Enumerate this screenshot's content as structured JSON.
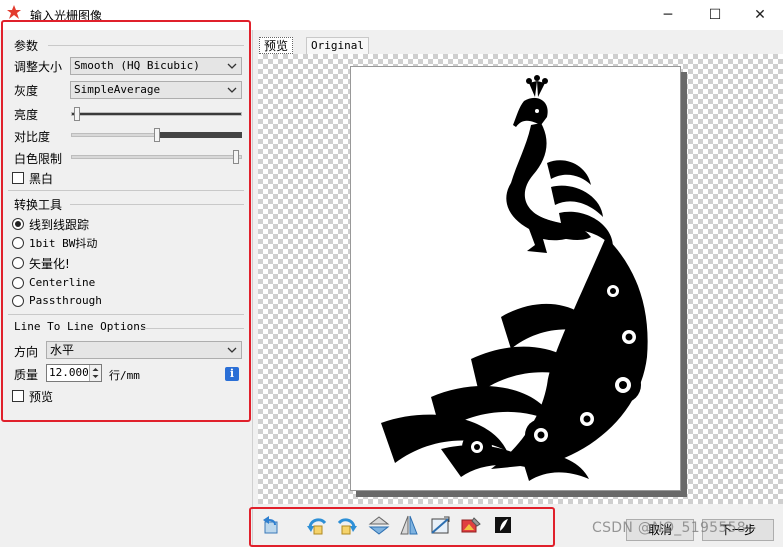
{
  "window": {
    "title": "输入光栅图像",
    "minimize": "─",
    "maximize": "☐",
    "close": "✕"
  },
  "params": {
    "group_title": "参数",
    "resize_label": "调整大小",
    "resize_value": "Smooth (HQ Bicubic)",
    "gray_label": "灰度",
    "gray_value": "SimpleAverage",
    "brightness_label": "亮度",
    "brightness_level": 0.02,
    "contrast_label": "对比度",
    "contrast_level": 0.5,
    "white_limit_label": "白色限制",
    "white_limit_level": 0.98,
    "bw_label": "黑白",
    "bw_checked": false
  },
  "convert": {
    "group_title": "转换工具",
    "options": [
      {
        "label": "线到线跟踪",
        "selected": true
      },
      {
        "label": "1bit BW抖动",
        "selected": false
      },
      {
        "label": "矢量化!",
        "selected": false
      },
      {
        "label": "Centerline",
        "selected": false
      },
      {
        "label": "Passthrough",
        "selected": false
      }
    ]
  },
  "line_opts": {
    "group_title": "Line To Line Options",
    "direction_label": "方向",
    "direction_value": "水平",
    "quality_label": "质量",
    "quality_value": "12.000",
    "quality_unit": "行/mm",
    "info_icon": "i",
    "preview_label": "预览",
    "preview_checked": false
  },
  "tabs": [
    {
      "label": "预览",
      "active": true
    },
    {
      "label": "Original",
      "active": false
    }
  ],
  "toolbar": {
    "icons": [
      "reset-icon",
      "rotate-left-icon",
      "rotate-right-icon",
      "flip-vertical-icon",
      "flip-horizontal-icon",
      "crop-icon",
      "sharpen-icon",
      "invert-icon"
    ]
  },
  "buttons": {
    "cancel": "取消",
    "next": "下一步"
  },
  "watermark": "CSDN @NO_5195558",
  "colors": {
    "highlight": "#e0202b",
    "info": "#2a6fd6"
  }
}
